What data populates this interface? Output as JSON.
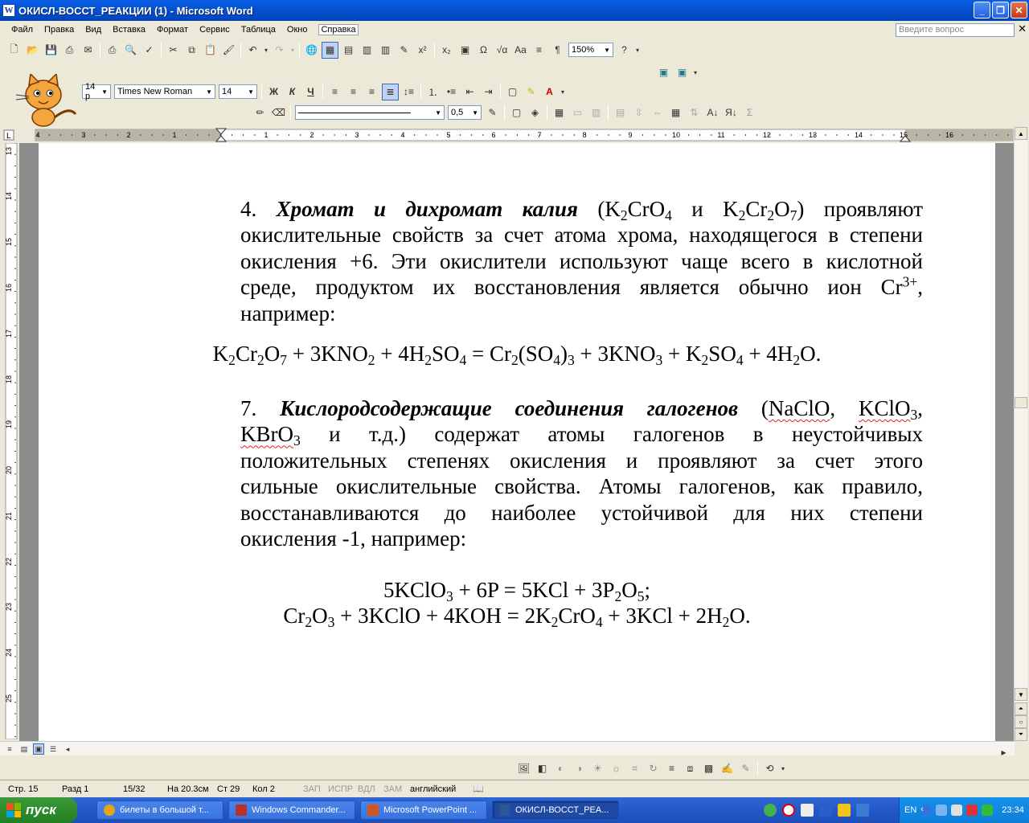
{
  "window": {
    "title": "ОКИСЛ-ВОССТ_РЕАКЦИИ (1) - Microsoft Word",
    "app_icon": "W"
  },
  "menu": {
    "items": [
      "Файл",
      "Правка",
      "Вид",
      "Вставка",
      "Формат",
      "Сервис",
      "Таблица",
      "Окно",
      "Справка"
    ],
    "help_placeholder": "Введите вопрос"
  },
  "toolbar": {
    "zoom": "150%",
    "style_size": "14 p",
    "font": "Times New Roman",
    "size": "14",
    "line_weight": "0,5",
    "bold": "Ж",
    "italic": "К",
    "underline": "Ч",
    "sigma": "Σ"
  },
  "ruler": {
    "h_ticks": [
      "4",
      "3",
      "2",
      "1",
      "1",
      "2",
      "3",
      "4",
      "5",
      "6",
      "7",
      "8",
      "9",
      "10",
      "11",
      "12",
      "13",
      "14",
      "15",
      "16"
    ],
    "v_ticks": [
      "13",
      "14",
      "15",
      "16",
      "17",
      "18",
      "19",
      "20",
      "21",
      "22",
      "23",
      "24",
      "25"
    ]
  },
  "document": {
    "p4_lines": [
      {
        "parts": [
          [
            "t",
            "4. "
          ],
          [
            "bi",
            "Хромат и дихромат калия"
          ],
          [
            "t",
            " (K"
          ],
          [
            "sub",
            "2"
          ],
          [
            "t",
            "CrO"
          ],
          [
            "sub",
            "4"
          ],
          [
            "t",
            " и K"
          ],
          [
            "sub",
            "2"
          ],
          [
            "t",
            "Cr"
          ],
          [
            "sub",
            "2"
          ],
          [
            "t",
            "O"
          ],
          [
            "sub",
            "7"
          ],
          [
            "t",
            ") проявляют"
          ]
        ]
      },
      {
        "parts": [
          [
            "t",
            "окислительные свойств за счет атома хрома, находящегося в степени"
          ]
        ]
      },
      {
        "parts": [
          [
            "t",
            "окисления +6. Эти окислители используют чаще всего в кислотной"
          ]
        ]
      },
      {
        "parts": [
          [
            "t",
            "среде, продуктом их восстановления является обычно ион Cr"
          ],
          [
            "sup",
            "3+"
          ],
          [
            "t",
            ","
          ]
        ]
      },
      {
        "parts": [
          [
            "t",
            "например:"
          ]
        ]
      }
    ],
    "eq1": [
      [
        "t",
        "K"
      ],
      [
        "sub",
        "2"
      ],
      [
        "t",
        "Cr"
      ],
      [
        "sub",
        "2"
      ],
      [
        "t",
        "O"
      ],
      [
        "sub",
        "7"
      ],
      [
        "t",
        " + 3KNO"
      ],
      [
        "sub",
        "2"
      ],
      [
        "t",
        " + 4H"
      ],
      [
        "sub",
        "2"
      ],
      [
        "t",
        "SO"
      ],
      [
        "sub",
        "4"
      ],
      [
        "t",
        " = Cr"
      ],
      [
        "sub",
        "2"
      ],
      [
        "t",
        "(SO"
      ],
      [
        "sub",
        "4"
      ],
      [
        "t",
        ")"
      ],
      [
        "sub",
        "3"
      ],
      [
        "t",
        " + 3KNO"
      ],
      [
        "sub",
        "3"
      ],
      [
        "t",
        " + K"
      ],
      [
        "sub",
        "2"
      ],
      [
        "t",
        "SO"
      ],
      [
        "sub",
        "4"
      ],
      [
        "t",
        " + 4H"
      ],
      [
        "sub",
        "2"
      ],
      [
        "t",
        "O."
      ]
    ],
    "p7_lines": [
      {
        "parts": [
          [
            "t",
            "7. "
          ],
          [
            "bi",
            "Кислородсодержащие соединения галогенов"
          ],
          [
            "t",
            " ("
          ],
          [
            "sq",
            "NaClO"
          ],
          [
            "t",
            ", "
          ],
          [
            "sq",
            "KClO"
          ],
          [
            "sub",
            "3"
          ],
          [
            "t",
            ","
          ]
        ]
      },
      {
        "parts": [
          [
            "sq",
            "KBrO"
          ],
          [
            "sub",
            "3"
          ],
          [
            "t",
            " и т.д.) содержат атомы галогенов в неустойчивых"
          ]
        ]
      },
      {
        "parts": [
          [
            "t",
            "положительных степенях окисления и проявляют за счет этого"
          ]
        ]
      },
      {
        "parts": [
          [
            "t",
            "сильные окислительные свойства. Атомы галогенов, как правило,"
          ]
        ]
      },
      {
        "parts": [
          [
            "t",
            "восстанавливаются до наиболее устойчивой для них степени"
          ]
        ]
      },
      {
        "parts": [
          [
            "t",
            "окисления -1, например:"
          ]
        ]
      }
    ],
    "eq2": [
      [
        "t",
        "5KClO"
      ],
      [
        "sub",
        "3"
      ],
      [
        "t",
        " + 6P = 5KCl + 3P"
      ],
      [
        "sub",
        "2"
      ],
      [
        "t",
        "O"
      ],
      [
        "sub",
        "5"
      ],
      [
        "t",
        ";"
      ]
    ],
    "eq3": [
      [
        "t",
        "Cr"
      ],
      [
        "sub",
        "2"
      ],
      [
        "t",
        "O"
      ],
      [
        "sub",
        "3"
      ],
      [
        "t",
        " + 3KClO + 4KOH = 2K"
      ],
      [
        "sub",
        "2"
      ],
      [
        "t",
        "CrO"
      ],
      [
        "sub",
        "4"
      ],
      [
        "t",
        " + 3KCl + 2H"
      ],
      [
        "sub",
        "2"
      ],
      [
        "t",
        "O."
      ]
    ]
  },
  "status": {
    "page": "Стр. 15",
    "section": "Разд 1",
    "pages": "15/32",
    "at": "На 20.3см",
    "line": "Ст 29",
    "col": "Кол 2",
    "rec": "ЗАП",
    "trk": "ИСПР",
    "ext": "ВДЛ",
    "ovr": "ЗАМ",
    "lang": "английский"
  },
  "taskbar": {
    "start": "пуск",
    "tasks": [
      {
        "label": "билеты в большой т...",
        "color": "#e8a317"
      },
      {
        "label": "Windows Commander...",
        "color": "#b8322a"
      },
      {
        "label": "Microsoft PowerPoint ...",
        "color": "#d4541f"
      },
      {
        "label": "ОКИСЛ-ВОССТ_РЕА...",
        "color": "#2b579a"
      }
    ],
    "lang": "EN",
    "clock": "23:34"
  }
}
